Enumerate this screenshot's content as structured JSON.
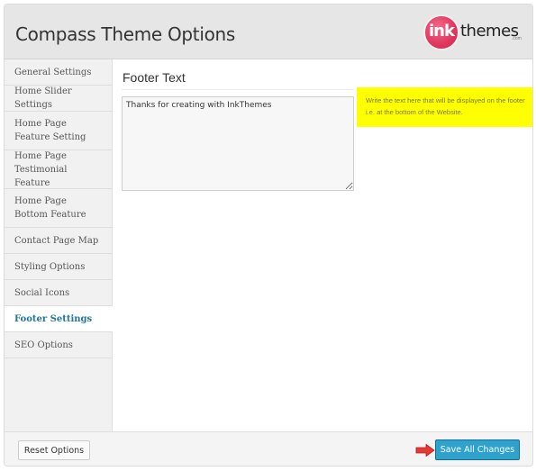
{
  "header": {
    "title": "Compass Theme Options",
    "logo": {
      "mark": "ink",
      "text": "themes",
      "suffix": ".com"
    }
  },
  "sidebar": {
    "items": [
      {
        "label": "General Settings",
        "active": false
      },
      {
        "label": "Home Slider Settings",
        "active": false
      },
      {
        "label": "Home Page Feature Setting",
        "active": false
      },
      {
        "label": "Home Page Testimonial Feature",
        "active": false
      },
      {
        "label": "Home Page Bottom Feature",
        "active": false
      },
      {
        "label": "Contact Page Map",
        "active": false
      },
      {
        "label": "Styling Options",
        "active": false
      },
      {
        "label": "Social Icons",
        "active": false
      },
      {
        "label": "Footer Settings",
        "active": true
      },
      {
        "label": "SEO Options",
        "active": false
      }
    ]
  },
  "main": {
    "section_title": "Footer Text",
    "footer_text_value": "Thanks for creating with InkThemes",
    "help_text": "Write the text here that will be displayed on the footer i.e. at the bottom of the Website.",
    "help_color": "#ffff00"
  },
  "footer": {
    "reset_label": "Reset Options",
    "save_label": "Save All Changes",
    "accent_color": "#2ea2cc",
    "arrow_icon": "red-arrow-right-icon"
  }
}
